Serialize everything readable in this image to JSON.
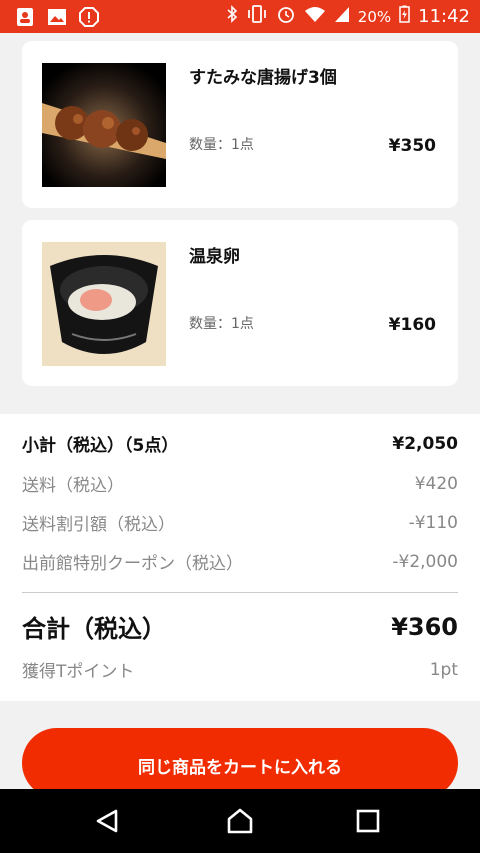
{
  "status_bar": {
    "icons_left": [
      "contact-card-icon",
      "image-icon",
      "alert-icon"
    ],
    "icons_right": [
      "bluetooth-icon",
      "vibrate-icon",
      "alarm-icon",
      "wifi-icon",
      "signal-icon",
      "battery-icon"
    ],
    "battery": "20%",
    "time": "11:42"
  },
  "items": [
    {
      "name": "すたみな唐揚げ3個",
      "qty": "数量：1点",
      "price": "¥350"
    },
    {
      "name": "温泉卵",
      "qty": "数量：1点",
      "price": "¥160"
    }
  ],
  "summary": {
    "subtotal_label": "小計（税込）（5点）",
    "subtotal_value": "¥2,050",
    "shipping_label": "送料（税込）",
    "shipping_value": "¥420",
    "shipping_discount_label": "送料割引額（税込）",
    "shipping_discount_value": "-¥110",
    "coupon_label": "出前館特別クーポン（税込）",
    "coupon_value": "-¥2,000",
    "total_label": "合計（税込）",
    "total_value": "¥360",
    "points_label": "獲得Tポイント",
    "points_value": "1pt"
  },
  "cta_label": "同じ商品をカートに入れる",
  "nav": [
    "back-icon",
    "home-icon",
    "recents-icon"
  ],
  "colors": {
    "accent": "#f02c00",
    "status_bar": "#e8381b"
  }
}
